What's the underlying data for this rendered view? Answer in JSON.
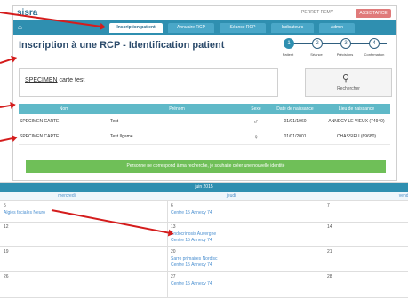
{
  "app": {
    "logo": "sisra",
    "user": "PERRET REMY",
    "assistance": "ASSISTANCE"
  },
  "tabs": [
    {
      "label": "Inscription patient",
      "active": true
    },
    {
      "label": "Annuaire RCP",
      "active": false
    },
    {
      "label": "Séance RCP",
      "active": false
    },
    {
      "label": "Indicateurs",
      "active": false
    },
    {
      "label": "Admin",
      "active": false
    }
  ],
  "page": {
    "title": "Inscription à une RCP - Identification patient"
  },
  "steps": [
    {
      "num": "1",
      "label": "Patient"
    },
    {
      "num": "2",
      "label": "Séance"
    },
    {
      "num": "3",
      "label": "Précisions"
    },
    {
      "num": "4",
      "label": "Confirmation"
    }
  ],
  "search": {
    "value_underlined": "SPECIMEN",
    "value_rest": " carte test",
    "button_label": "Rechercher"
  },
  "results": {
    "headers": [
      "Nom",
      "Prénom",
      "Sexe",
      "Date de naissance",
      "Lieu de naissance"
    ],
    "rows": [
      {
        "nom": "SPECIMEN CARTE",
        "prenom": "Test",
        "sexe": "♂",
        "date": "01/01/1960",
        "lieu": "ANNECY LE VIEUX (74940)"
      },
      {
        "nom": "SPECIMEN CARTE",
        "prenom": "Test Ilgame",
        "sexe": "♀",
        "date": "01/01/2001",
        "lieu": "CHASSIEU (69680)"
      }
    ]
  },
  "create_button": "Personne ne correspond à ma recherche, je souhaite créer une nouvelle identité",
  "calendar": {
    "month": "juin 2015",
    "days": [
      "mercredi",
      "jeudi",
      "vendr"
    ],
    "weeks": [
      {
        "cells": [
          {
            "num": "5",
            "events": [
              "Algies faciales Neuro"
            ]
          },
          {
            "num": "6",
            "events": [
              "Centre 15 Annecy 74"
            ]
          },
          {
            "num": "7",
            "events": []
          }
        ]
      },
      {
        "cells": [
          {
            "num": "12",
            "events": []
          },
          {
            "num": "13",
            "events": [
              "Endocrinosis Auvergne",
              "Centre 15 Annecy 74"
            ]
          },
          {
            "num": "14",
            "events": []
          }
        ]
      },
      {
        "cells": [
          {
            "num": "19",
            "events": []
          },
          {
            "num": "20",
            "events": [
              "Sarro primaires Nordlsc",
              "Centre 15 Annecy 74"
            ]
          },
          {
            "num": "21",
            "events": []
          }
        ]
      },
      {
        "cells": [
          {
            "num": "26",
            "events": []
          },
          {
            "num": "27",
            "events": [
              "Centre 15 Annecy 74"
            ]
          },
          {
            "num": "28",
            "events": []
          }
        ]
      }
    ]
  },
  "colors": {
    "primary": "#2f8fb0",
    "table_header": "#5fb9c8",
    "create": "#6fbf58",
    "arrow": "#d41c1c",
    "title": "#2c4b6b"
  }
}
